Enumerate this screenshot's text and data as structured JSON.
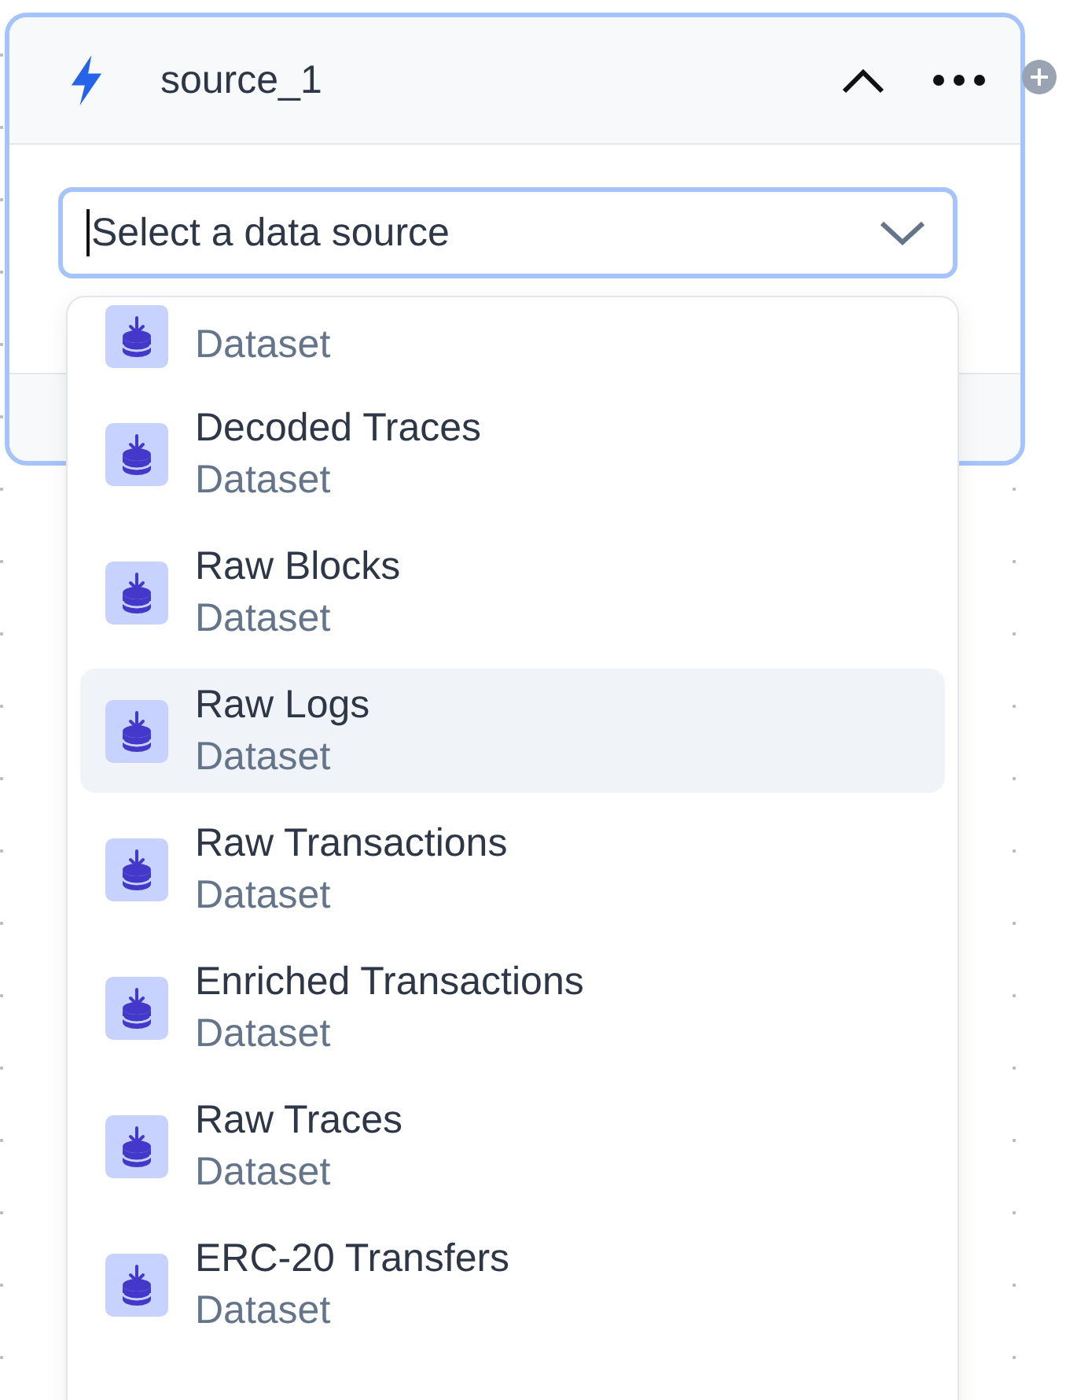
{
  "node": {
    "title": "source_1",
    "expanded": true
  },
  "select": {
    "placeholder": "Select a data source"
  },
  "options": [
    {
      "subtitle": "Dataset",
      "selected": false
    },
    {
      "title": "Decoded Traces",
      "subtitle": "Dataset",
      "selected": false
    },
    {
      "title": "Raw Blocks",
      "subtitle": "Dataset",
      "selected": false
    },
    {
      "title": "Raw Logs",
      "subtitle": "Dataset",
      "selected": true
    },
    {
      "title": "Raw Transactions",
      "subtitle": "Dataset",
      "selected": false
    },
    {
      "title": "Enriched Transactions",
      "subtitle": "Dataset",
      "selected": false
    },
    {
      "title": "Raw Traces",
      "subtitle": "Dataset",
      "selected": false
    },
    {
      "title": "ERC-20 Transfers",
      "subtitle": "Dataset",
      "selected": false
    }
  ]
}
